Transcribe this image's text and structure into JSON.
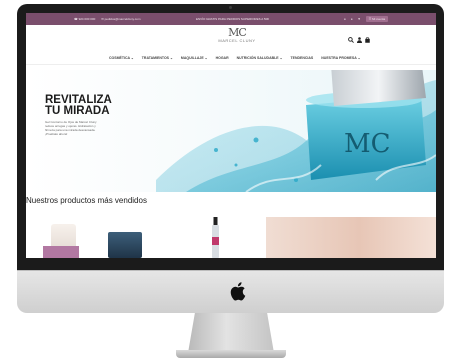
{
  "topbar": {
    "phone": "☎ 924 000 000",
    "email": "✉ pedidos@marcelcluny.com",
    "promo": "ENVÍO GRATIS PARA PEDIDOS SUPERIORES A 50€",
    "account": "☰ Mi cuenta"
  },
  "header": {
    "brand_mark": "MC",
    "brand_name": "MARCEL CLUNY"
  },
  "nav": {
    "items": [
      {
        "label": "COSMÉTICA ⌄"
      },
      {
        "label": "TRATAMIENTOS ⌄"
      },
      {
        "label": "MAQUILLAJE ⌄"
      },
      {
        "label": "HOGAR"
      },
      {
        "label": "NUTRICIÓN SALUDABLE ⌄"
      },
      {
        "label": "TENDENCIAS"
      },
      {
        "label": "NUESTRA PROMESA ⌄"
      }
    ]
  },
  "hero": {
    "title": "REVITALIZA TU MIRADA",
    "text": "Gel Contorno de Ojos de Marcel Cluny reduce arrugas y ojeras. Hidratación y firmeza para una mirada descansada. ¡Pruébalo ahora!",
    "jar_text": "MC"
  },
  "products": {
    "title": "Nuestros productos más vendidos"
  },
  "colors": {
    "topbar": "#7a4e6c",
    "accent": "#b278a2",
    "water": "#29b4d0"
  }
}
